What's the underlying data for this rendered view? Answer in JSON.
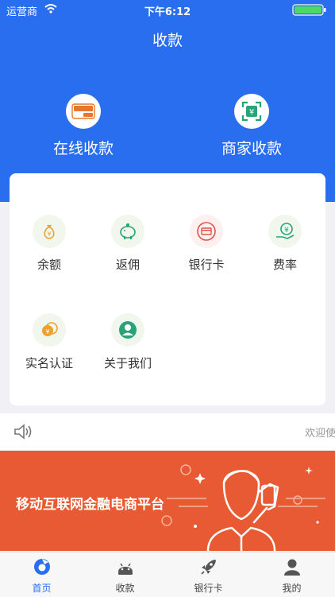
{
  "status_bar": {
    "carrier": "运营商",
    "time": "下午6:12"
  },
  "header": {
    "title": "收款",
    "buttons": [
      {
        "label": "在线收款",
        "icon": "unionpay-card-icon"
      },
      {
        "label": "商家收款",
        "icon": "merchant-qr-icon"
      }
    ]
  },
  "grid": [
    {
      "label": "余额",
      "icon": "money-bag-icon"
    },
    {
      "label": "返佣",
      "icon": "piggy-bank-icon"
    },
    {
      "label": "银行卡",
      "icon": "bank-card-icon"
    },
    {
      "label": "费率",
      "icon": "rate-hand-icon"
    },
    {
      "label": "实名认证",
      "icon": "coins-icon"
    },
    {
      "label": "关于我们",
      "icon": "user-icon"
    }
  ],
  "notice": {
    "text": "欢迎使"
  },
  "banner": {
    "text": "移动互联网金融电商平台"
  },
  "tabbar": [
    {
      "label": "首页",
      "icon": "home-icon",
      "active": true
    },
    {
      "label": "收款",
      "icon": "android-icon",
      "active": false
    },
    {
      "label": "银行卡",
      "icon": "rocket-icon",
      "active": false
    },
    {
      "label": "我的",
      "icon": "profile-icon",
      "active": false
    }
  ],
  "colors": {
    "primary": "#2a6ef0",
    "banner": "#e85a33",
    "accent_icon": "#29a37a"
  }
}
